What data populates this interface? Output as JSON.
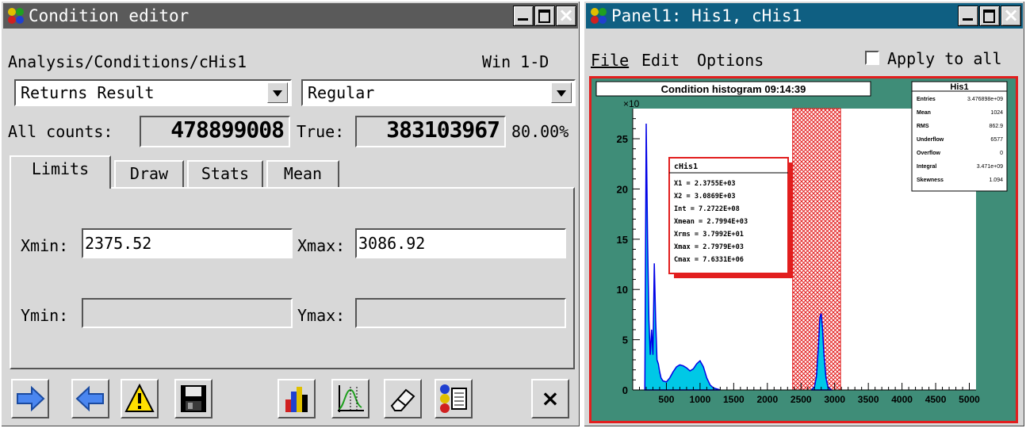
{
  "condition_editor": {
    "title": "Condition editor",
    "path": "Analysis/Conditions/cHis1",
    "window_info": "Win 1-D",
    "result_mode": "Returns Result",
    "condition_mode": "Regular",
    "all_counts_label": "All counts:",
    "all_counts_value": "478899008",
    "true_label": "True:",
    "true_value": "383103967",
    "percent": "80.00%",
    "tabs": [
      "Limits",
      "Draw",
      "Stats",
      "Mean"
    ],
    "xmin_label": "Xmin:",
    "xmin_value": "2375.52",
    "xmax_label": "Xmax:",
    "xmax_value": "3086.92",
    "ymin_label": "Ymin:",
    "ymin_value": "",
    "ymax_label": "Ymax:",
    "ymax_value": "",
    "close_glyph": "×",
    "toolbar_icons": [
      "arrow-right-icon",
      "arrow-left-icon",
      "warning-icon",
      "save-icon",
      "histogram-icon",
      "graph-icon",
      "eraser-icon",
      "info-list-icon",
      "close-icon"
    ]
  },
  "panel": {
    "title": "Panel1: His1, cHis1",
    "menu": [
      "File",
      "Edit",
      "Options"
    ],
    "apply_all": "Apply to all",
    "apply_all_checked": false
  },
  "chart_data": {
    "type": "line",
    "title": "Condition histogram 09:14:39",
    "x_ticks": [
      "500",
      "1000",
      "1500",
      "2000",
      "2500",
      "3000",
      "3500",
      "4000",
      "4500",
      "5000"
    ],
    "y_ticks": [
      "0",
      "5",
      "10",
      "15",
      "20",
      "25"
    ],
    "y_exponent": "×10",
    "xlim": [
      0,
      5100
    ],
    "ylim": [
      0,
      28
    ],
    "condition_window": [
      2375.52,
      3086.92
    ],
    "series": [
      {
        "x": [
          180,
          200,
          220,
          240,
          260,
          280,
          300,
          320,
          340,
          360,
          380,
          400,
          420,
          450,
          500,
          550,
          600,
          650,
          700,
          750,
          800,
          850,
          900,
          950,
          1000,
          1050,
          1100,
          1150,
          1200,
          1250,
          1300
        ],
        "values": [
          0.5,
          26.5,
          15,
          7,
          3.5,
          6,
          3.5,
          12.6,
          7,
          3,
          2.6,
          1.8,
          1.2,
          0.9,
          0.8,
          1.2,
          1.8,
          2.3,
          2.5,
          2.4,
          2.2,
          1.9,
          2.1,
          2.6,
          2.9,
          2.3,
          1.2,
          0.5,
          0.2,
          0.1,
          0
        ]
      },
      {
        "x": [
          2650,
          2700,
          2730,
          2760,
          2780,
          2800,
          2820,
          2840,
          2870,
          2900,
          2950
        ],
        "values": [
          0,
          0.3,
          1.4,
          4.5,
          7.2,
          7.6,
          6.1,
          3.6,
          1.2,
          0.3,
          0
        ]
      }
    ]
  },
  "stats_box": {
    "title": "His1",
    "rows": [
      [
        "Entries",
        "3.476898e+09"
      ],
      [
        "Mean",
        "1024"
      ],
      [
        "RMS",
        "862.9"
      ],
      [
        "Underflow",
        "6577"
      ],
      [
        "Overflow",
        "0"
      ],
      [
        "Integral",
        "3.471e+09"
      ],
      [
        "Skewness",
        "1.094"
      ]
    ]
  },
  "cond_box": {
    "title": "cHis1",
    "rows": [
      "X1     = 2.3755E+03",
      "X2     = 3.0869E+03",
      "Int    = 7.2722E+08",
      "Xmean  = 2.7994E+03",
      "Xrms   = 3.7992E+01",
      "Xmax   = 2.7979E+03",
      "Cmax   = 7.6331E+06"
    ]
  },
  "colors": {
    "title_bg": "#0f5f82",
    "frame_green": "#3f8d78",
    "condition_red": "#e21e1e",
    "histo_blue": "#0000e6",
    "histo_fill": "#00c8e6"
  }
}
